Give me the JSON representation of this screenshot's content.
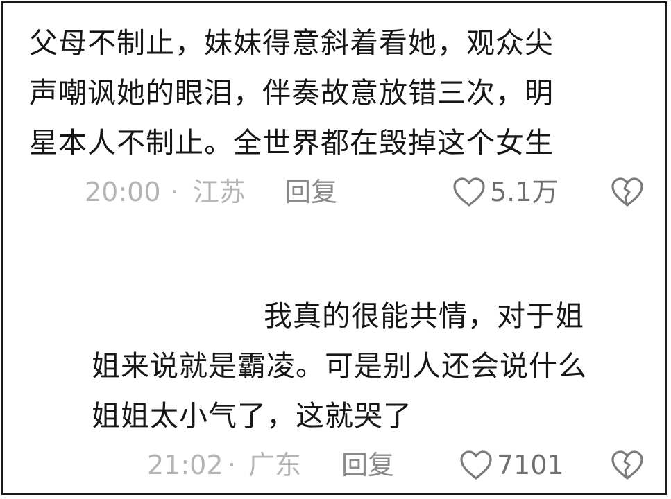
{
  "comments": [
    {
      "lines": [
        "父母不制止，妹妹得意斜着看她，观众尖",
        "声嘲讽她的眼泪，伴奏故意放错三次，明",
        "星本人不制止。全世界都在毁掉这个女生"
      ],
      "time": "20:00",
      "separator": "·",
      "location": "江苏",
      "reply_label": "回复",
      "like_count": "5.1万"
    },
    {
      "lines": [
        "我真的很能共情，对于姐",
        "姐来说就是霸凌。可是别人还会说什么",
        "姐姐太小气了，这就哭了"
      ],
      "time": "21:02",
      "separator": "·",
      "location": "广东",
      "reply_label": "回复",
      "like_count": "7101"
    }
  ],
  "icons": {
    "like": "heart-outline-icon",
    "dislike": "broken-heart-icon"
  },
  "colors": {
    "text": "#161616",
    "meta": "#b4b4b4",
    "action": "#8a8a8a",
    "border": "#1a1a1a"
  }
}
